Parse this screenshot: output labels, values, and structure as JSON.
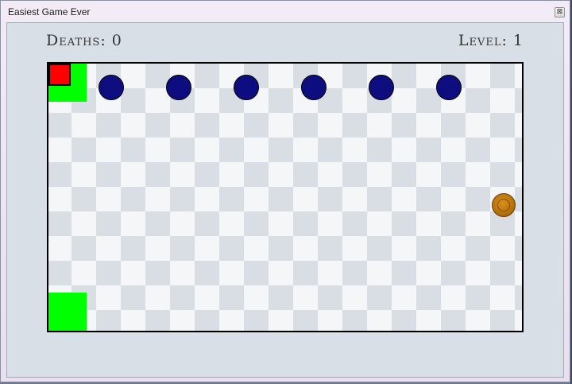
{
  "window": {
    "title": "Easiest Game Ever",
    "close_glyph": "⊠"
  },
  "hud": {
    "deaths_label": "Deaths:",
    "deaths_value": "0",
    "level_label": "Level:",
    "level_value": "1"
  },
  "colors": {
    "safe_zone": "#00ff00",
    "player": "#ff0000",
    "enemy": "#0d0d80",
    "coin": "#b8740d",
    "board_light": "#f4f6f8",
    "board_dark": "#d9dee5",
    "window_bg": "#d9dfe7"
  },
  "board": {
    "enemy_count": 6,
    "coin_count": 1
  },
  "icons": {
    "close": "close-icon",
    "coin": "coin-icon"
  }
}
